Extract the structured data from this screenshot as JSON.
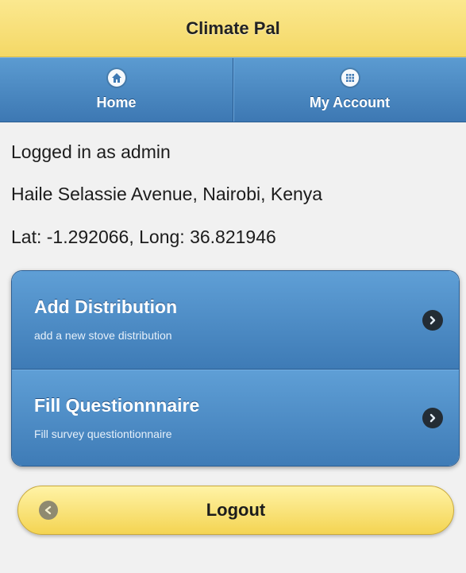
{
  "header": {
    "title": "Climate Pal"
  },
  "navbar": {
    "items": [
      {
        "label": "Home",
        "icon": "home-icon"
      },
      {
        "label": "My Account",
        "icon": "grid-icon"
      }
    ]
  },
  "info": {
    "logged_in": "Logged in as admin",
    "address": "Haile Selassie Avenue, Nairobi, Kenya",
    "coordinates": "Lat: -1.292066, Long: 36.821946"
  },
  "menu": {
    "items": [
      {
        "title": "Add Distribution",
        "subtitle": "add a new stove distribution",
        "icon": "chevron-right-icon"
      },
      {
        "title": "Fill Questionnnaire",
        "subtitle": "Fill survey questiontionnaire",
        "icon": "chevron-right-icon"
      }
    ]
  },
  "logout": {
    "label": "Logout",
    "icon": "back-arrow-icon"
  },
  "colors": {
    "header_bg": "#f4d866",
    "nav_bg": "#3d78b3",
    "list_bg": "#4a8ac4",
    "logout_bg": "#f4d452"
  }
}
